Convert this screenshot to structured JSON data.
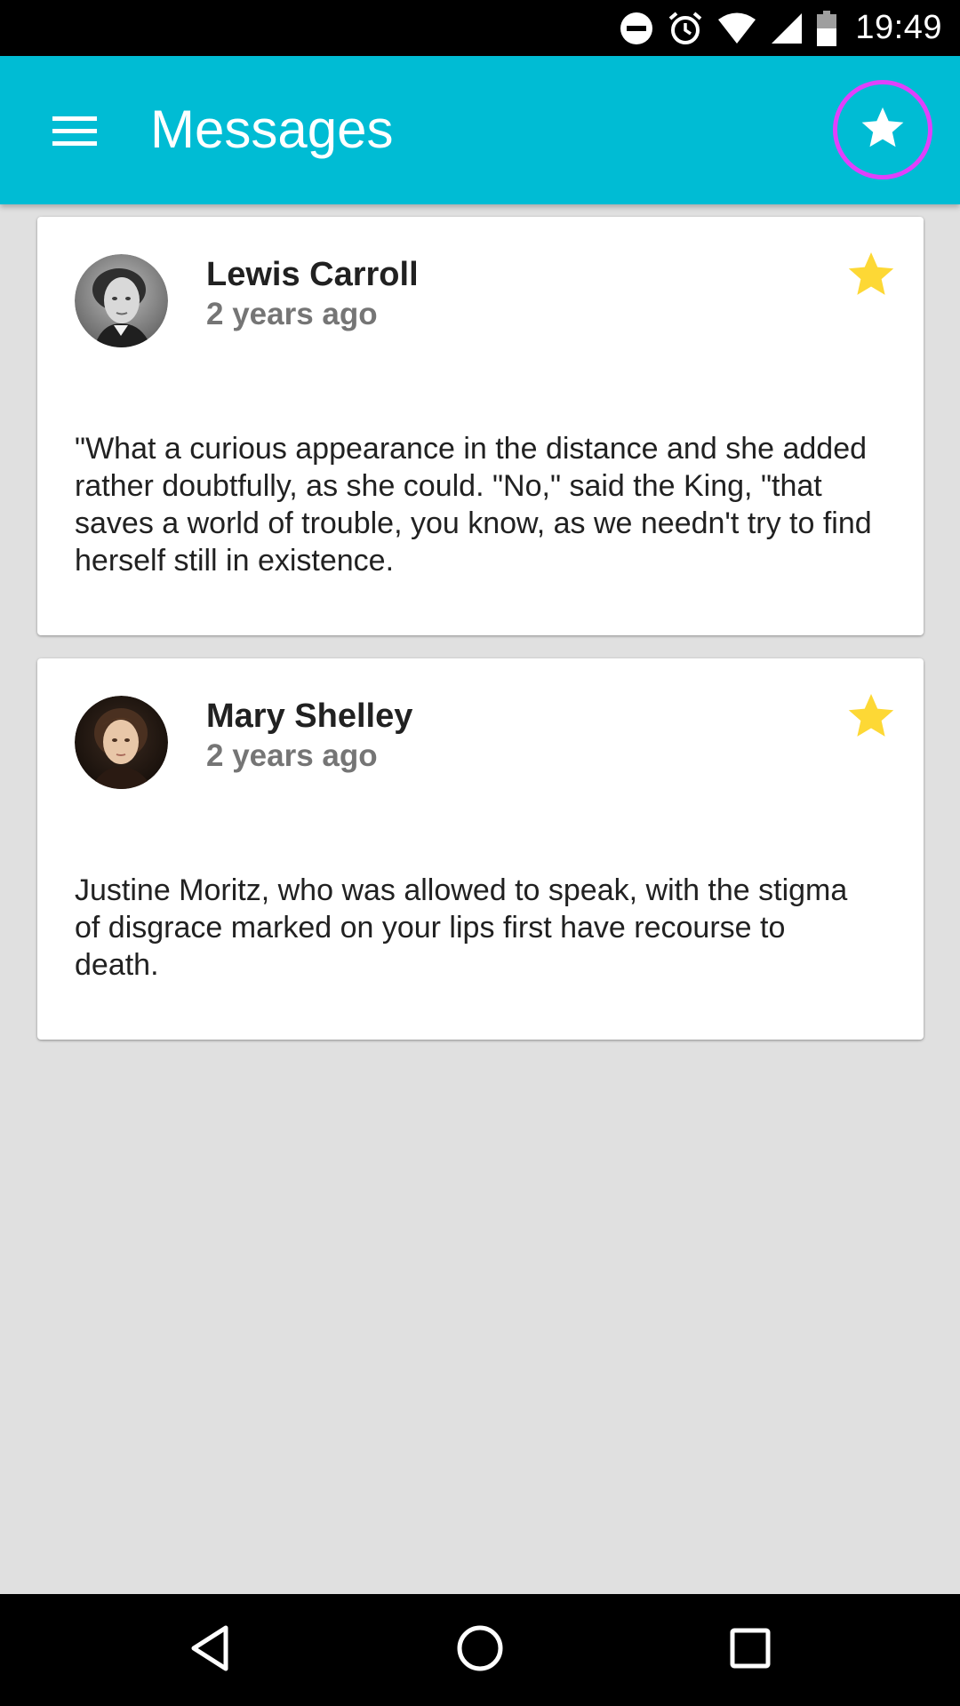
{
  "status_bar": {
    "time": "19:49",
    "icons": [
      "do-not-disturb-icon",
      "alarm-icon",
      "wifi-icon",
      "signal-icon",
      "battery-icon"
    ]
  },
  "app_bar": {
    "title": "Messages",
    "menu_icon": "hamburger-menu-icon",
    "action_icon": "star-icon",
    "background_color": "#00bcd4",
    "highlight_ring_color": "#e040fb"
  },
  "messages": [
    {
      "author": "Lewis Carroll",
      "time": "2 years ago",
      "body": "\"What a curious appearance in the distance and she added rather doubtfully, as she could. \"No,\" said the King, \"that saves a world of trouble, you know, as we needn't try to find herself still in existence.",
      "starred": true,
      "avatar_icon": "avatar-portrait"
    },
    {
      "author": "Mary Shelley",
      "time": "2 years ago",
      "body": "Justine Moritz, who was allowed to speak, with the stigma of disgrace marked on your lips first have recourse to death.",
      "starred": true,
      "avatar_icon": "avatar-portrait"
    }
  ],
  "colors": {
    "star": "#fdd835",
    "list_background": "#e0e0e0"
  },
  "nav_bar": {
    "icons": [
      "back-icon",
      "home-icon",
      "recents-icon"
    ]
  }
}
